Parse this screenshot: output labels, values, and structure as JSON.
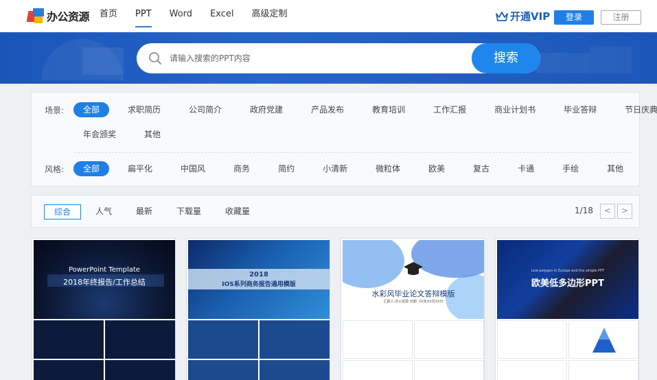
{
  "header": {
    "logo_text": "办公资源",
    "nav": [
      "首页",
      "PPT",
      "Word",
      "Excel",
      "高级定制"
    ],
    "active_nav": "PPT",
    "vip_label": "开通VIP",
    "login_label": "登录",
    "register_label": "注册"
  },
  "search": {
    "placeholder": "请输入搜索的PPT内容",
    "button_label": "搜索"
  },
  "filters": {
    "scene_label": "场景:",
    "scene_tags": [
      "全部",
      "求职简历",
      "公司简介",
      "政府党建",
      "产品发布",
      "教育培训",
      "工作汇报",
      "商业计划书",
      "毕业答辩",
      "节日庆典",
      "年会颁奖",
      "其他"
    ],
    "style_label": "风格:",
    "style_tags": [
      "全部",
      "扁平化",
      "中国风",
      "商务",
      "简约",
      "小清新",
      "微粒体",
      "欧美",
      "复古",
      "卡通",
      "手绘",
      "其他"
    ]
  },
  "sort": {
    "items": [
      "综合",
      "人气",
      "最新",
      "下载量",
      "收藏量"
    ],
    "active": "综合",
    "page_indicator": "1/18",
    "prev_label": "<",
    "next_label": ">"
  },
  "cards": [
    {
      "title_line1": "PowerPoint Template",
      "title_line2": "2018年终报告/工作总结"
    },
    {
      "title_line1": "2018",
      "title_line2": "IOS系列商务报告通用模版"
    },
    {
      "title_line1": "水彩风毕业论文答辩模版",
      "title_line2": "汇报人:办公资源    日期: XX年XX月XX日"
    },
    {
      "title_line1": "Low polygon in Europe and the simple PPT",
      "title_line2": "欧美低多边形PPT"
    }
  ],
  "colors": {
    "accent": "#1f7fe5",
    "banner": "#1a55b8",
    "vip": "#1f5fb3"
  }
}
